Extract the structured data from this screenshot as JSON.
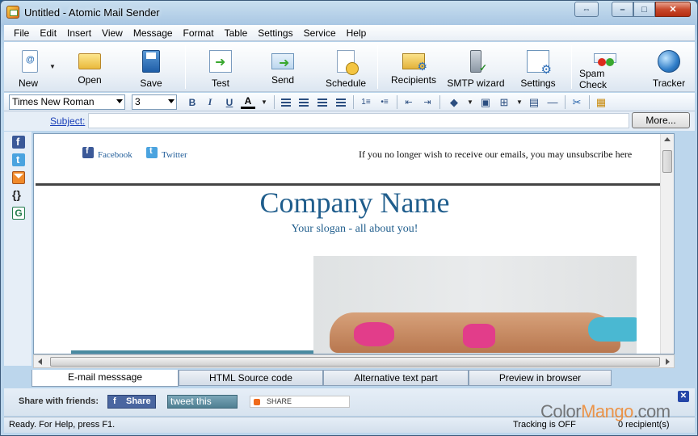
{
  "window": {
    "title": "Untitled - Atomic Mail Sender"
  },
  "menu": [
    "File",
    "Edit",
    "Insert",
    "View",
    "Message",
    "Format",
    "Table",
    "Settings",
    "Service",
    "Help"
  ],
  "toolbar": {
    "new": "New",
    "open": "Open",
    "save": "Save",
    "test": "Test",
    "send": "Send",
    "schedule": "Schedule",
    "recipients": "Recipients",
    "smtp": "SMTP wizard",
    "settings": "Settings",
    "spam": "Spam Check",
    "tracker": "Tracker"
  },
  "format": {
    "font": "Times New Roman",
    "size": "3"
  },
  "subject": {
    "label": "Subject:",
    "value": "",
    "more": "More..."
  },
  "email": {
    "facebook": "Facebook",
    "twitter": "Twitter",
    "unsubscribe": "If you no longer wish to receive our emails, you may unsubscribe here",
    "company": "Company Name",
    "slogan": "Your slogan - all about you!"
  },
  "tabs": [
    "E-mail messsage",
    "HTML Source code",
    "Alternative text part",
    "Preview in browser"
  ],
  "share": {
    "label": "Share with friends:",
    "fb": "Share",
    "tweet": "tweet this",
    "addthis": "SHARE"
  },
  "status": {
    "left": "Ready. For Help, press F1.",
    "tracking": "Tracking is OFF",
    "recipients": "0 recipient(s)"
  },
  "watermark": {
    "a": "Color",
    "b": "Mango",
    "c": ".com"
  }
}
